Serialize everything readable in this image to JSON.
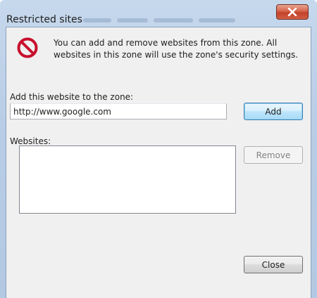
{
  "window": {
    "title": "Restricted sites",
    "close_icon": "close-x-icon"
  },
  "info": {
    "icon": "restricted-no-entry-icon",
    "text": "You can add and remove websites from this zone. All websites in this zone will use the zone's security settings."
  },
  "add_section": {
    "label": "Add this website to the zone:",
    "input_value": "http://www.google.com",
    "add_button_label": "Add"
  },
  "websites_section": {
    "label": "Websites:",
    "items": [],
    "remove_button_label": "Remove"
  },
  "footer": {
    "close_button_label": "Close"
  },
  "colors": {
    "restricted_icon_red": "#c8102e",
    "default_button_border": "#3c7fb1",
    "close_button_red": "#c2412a"
  }
}
